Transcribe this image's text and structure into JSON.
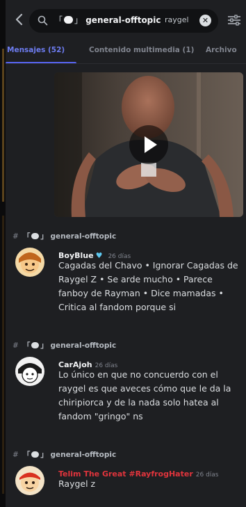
{
  "header": {
    "channel": "general-offtopic",
    "query": "raygel"
  },
  "tabs": [
    {
      "label": "Mensajes (52)"
    },
    {
      "label": "Contenido multimedia (1)"
    },
    {
      "label": "Archivo"
    }
  ],
  "results": [
    {
      "channel": "general-offtopic",
      "author": "BoyBlue",
      "time": "26 días",
      "text": "Cagadas del Chavo • Ignorar  Cagadas de Raygel Z • Se arde mucho • Parece fanboy de Rayman • Dice mamadas • Critica al fandom porque si"
    },
    {
      "channel": "general-offtopic",
      "author": "CarAjoh",
      "time": "26 días",
      "text": "Lo único en que no concuerdo con el raygel es que aveces cómo que le da la chiripiorca y de la nada solo hatea al fandom \"gringo\" ns"
    },
    {
      "channel": "general-offtopic",
      "author": "Telim The Great #RayfrogHater",
      "time": "26 días",
      "text": "Raygel z"
    }
  ],
  "colors": {
    "background": "#1e1f22",
    "accent": "#5865f2",
    "author_red": "#e0343c"
  }
}
